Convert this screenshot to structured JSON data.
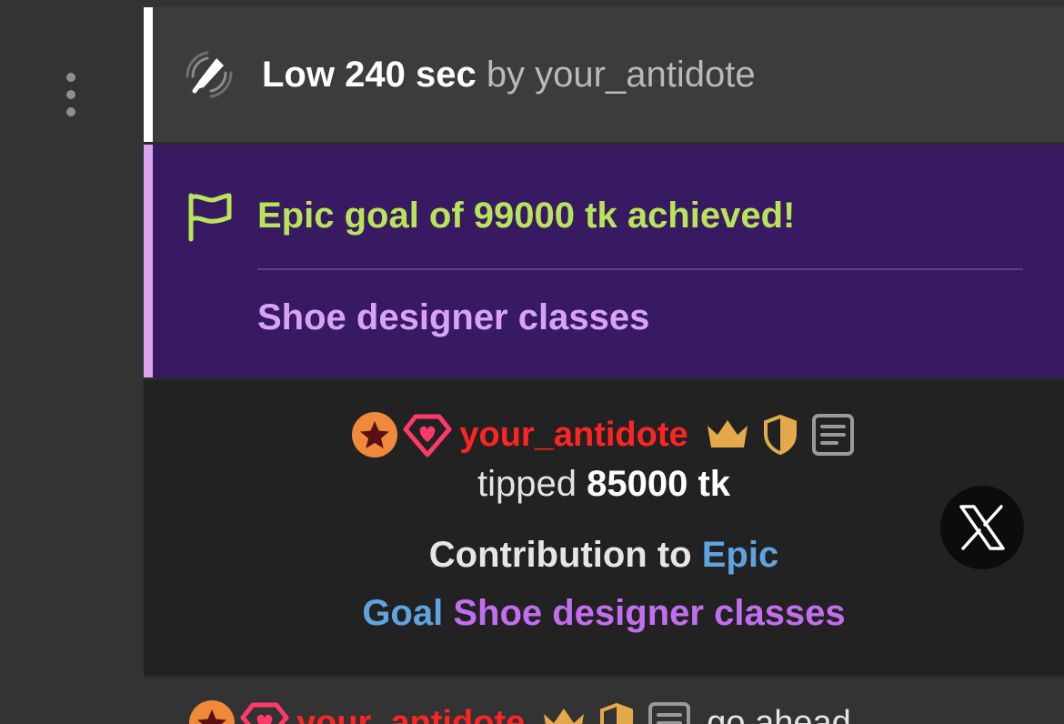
{
  "sidebar": {
    "menu_icon": "kebab-vertical-icon"
  },
  "low_notice": {
    "icon": "vibration-toy-icon",
    "title": "Low 240 sec",
    "by_label": "by your_antidote",
    "accent_color": "#ffffff"
  },
  "goal_notice": {
    "icon": "flag-icon",
    "title": "Epic goal of 99000 tk achieved!",
    "goal_name": "Shoe designer classes",
    "background": "#371a61",
    "title_color": "#b9e45a",
    "name_color": "#d8a3f4"
  },
  "tip_notice": {
    "username": "your_antidote",
    "badges": [
      "star-badge-icon",
      "heart-gem-icon",
      "crown-icon",
      "shield-icon",
      "note-icon"
    ],
    "tipped_label": "tipped",
    "amount": "85000 tk",
    "contribution_label": "Contribution to",
    "goal_word_epic": "Epic",
    "goal_word_goal": "Goal",
    "goal_name": "Shoe designer classes",
    "username_color": "#ff2424",
    "link_blue": "#5fa3e0",
    "link_purple": "#c36ef0",
    "share_icon": "x-logo-icon"
  },
  "next_message": {
    "username": "your_antidote",
    "message": "go ahead"
  }
}
